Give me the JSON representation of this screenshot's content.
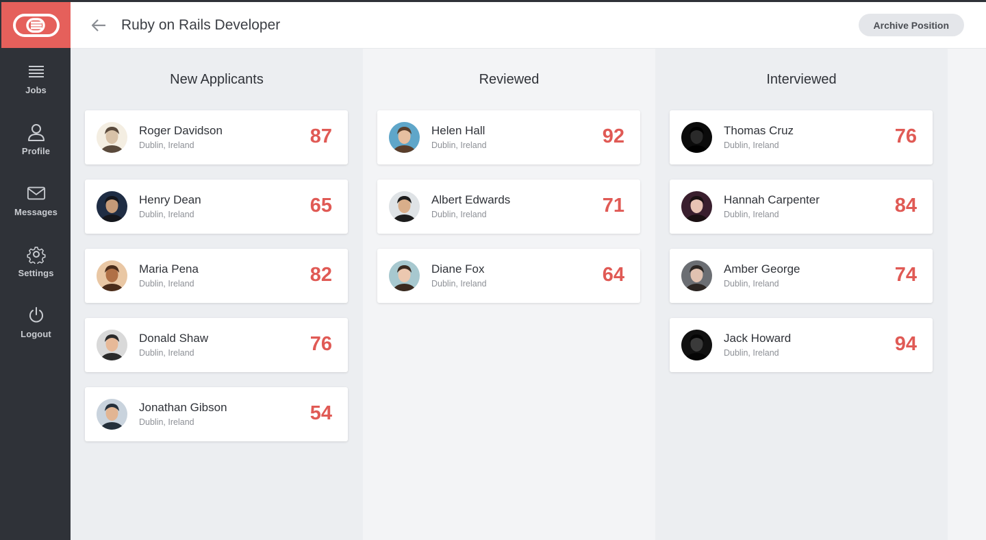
{
  "header": {
    "title": "Ruby on Rails Developer",
    "archive_label": "Archive Position"
  },
  "sidebar": {
    "items": [
      {
        "label": "Jobs",
        "icon": "menu-icon"
      },
      {
        "label": "Profile",
        "icon": "user-icon"
      },
      {
        "label": "Messages",
        "icon": "envelope-icon"
      },
      {
        "label": "Settings",
        "icon": "gear-icon"
      },
      {
        "label": "Logout",
        "icon": "power-icon"
      }
    ]
  },
  "colors": {
    "accent": "#e5605b",
    "score": "#e05a55",
    "sidebar": "#2f3238"
  },
  "columns": [
    {
      "title": "New Applicants",
      "candidates": [
        {
          "name": "Roger Davidson",
          "location": "Dublin, Ireland",
          "score": "87"
        },
        {
          "name": "Henry Dean",
          "location": "Dublin, Ireland",
          "score": "65"
        },
        {
          "name": "Maria Pena",
          "location": "Dublin, Ireland",
          "score": "82"
        },
        {
          "name": "Donald Shaw",
          "location": "Dublin, Ireland",
          "score": "76"
        },
        {
          "name": "Jonathan Gibson",
          "location": "Dublin, Ireland",
          "score": "54"
        }
      ]
    },
    {
      "title": "Reviewed",
      "candidates": [
        {
          "name": "Helen Hall",
          "location": "Dublin, Ireland",
          "score": "92"
        },
        {
          "name": "Albert Edwards",
          "location": "Dublin, Ireland",
          "score": "71"
        },
        {
          "name": "Diane Fox",
          "location": "Dublin, Ireland",
          "score": "64"
        }
      ]
    },
    {
      "title": "Interviewed",
      "candidates": [
        {
          "name": "Thomas Cruz",
          "location": "Dublin, Ireland",
          "score": "76"
        },
        {
          "name": "Hannah Carpenter",
          "location": "Dublin, Ireland",
          "score": "84"
        },
        {
          "name": "Amber George",
          "location": "Dublin, Ireland",
          "score": "74"
        },
        {
          "name": "Jack Howard",
          "location": "Dublin, Ireland",
          "score": "94"
        }
      ]
    }
  ]
}
